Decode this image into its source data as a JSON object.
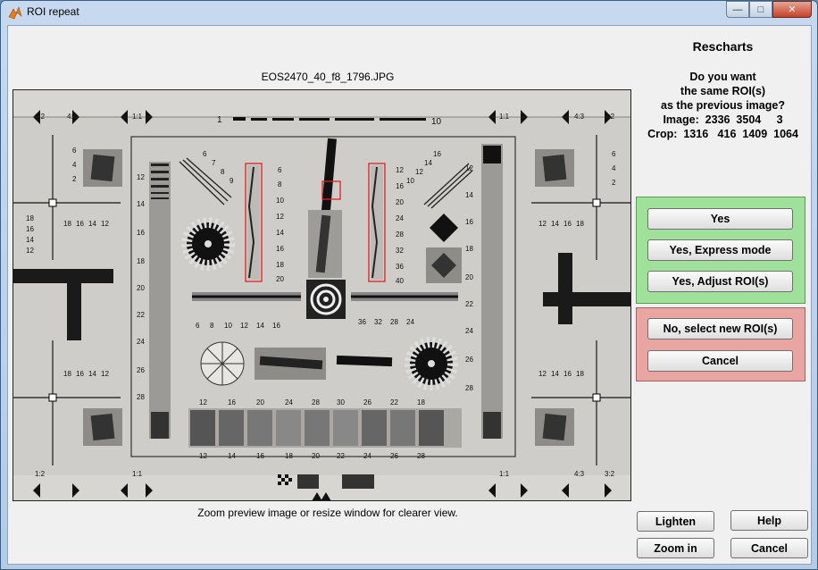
{
  "window": {
    "title": "ROI repeat"
  },
  "preview": {
    "filename": "EOS2470_40_f8_1796.JPG",
    "hint": "Zoom preview image or resize window for clearer view."
  },
  "sidebar": {
    "brand": "Rescharts",
    "question_lines": [
      "Do you want",
      "the same ROI(s)",
      "as the previous image?"
    ],
    "image_line": "Image:  2336  3504     3",
    "crop_line": "Crop:  1316   416  1409  1064"
  },
  "buttons": {
    "yes": "Yes",
    "yes_express": "Yes, Express mode",
    "yes_adjust": "Yes, Adjust ROI(s)",
    "no_new": "No, select new ROI(s)",
    "cancel_red": "Cancel",
    "lighten": "Lighten",
    "help": "Help",
    "zoom_in": "Zoom in",
    "cancel": "Cancel"
  },
  "chart_labels": {
    "corner_ratio_1": "1:2",
    "corner_ratio_2": "4:3",
    "corner_ratio_3": "1:1",
    "corner_ratio_4": "3:2",
    "top_scale_left": "1",
    "top_scale_right": "10",
    "bottom_nums_left": [
      "6",
      "8",
      "10",
      "12",
      "14",
      "16"
    ],
    "bottom_nums_right": [
      "36",
      "32",
      "28",
      "24"
    ],
    "bars_top_nums": [
      "12",
      "16",
      "20",
      "24",
      "28",
      "30",
      "26",
      "22",
      "18"
    ],
    "bars_bottom_nums": [
      "12",
      "14",
      "16",
      "18",
      "20",
      "22",
      "24",
      "26",
      "28"
    ],
    "left_mtf_nums": [
      "6",
      "8",
      "10",
      "12",
      "14",
      "16",
      "18",
      "20"
    ],
    "right_mtf_nums": [
      "12",
      "16",
      "20",
      "24",
      "28",
      "32",
      "36",
      "40"
    ],
    "vert_left_nums": [
      "12",
      "14",
      "16",
      "18",
      "20",
      "22",
      "24",
      "26",
      "28"
    ],
    "side_nums": [
      "6",
      "4",
      "2",
      "18",
      "16",
      "14",
      "12"
    ],
    "fan_nums_left": [
      "6",
      "7",
      "8",
      "9"
    ],
    "fan_nums_right": [
      "16",
      "14",
      "12",
      "10"
    ]
  },
  "colors": {
    "green_panel": "#9fe09a",
    "red_panel": "#e9a5a2",
    "roi_red": "#e02020"
  }
}
